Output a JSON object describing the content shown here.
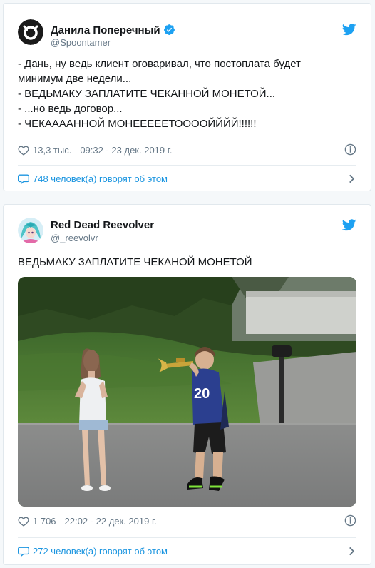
{
  "tweets": [
    {
      "author_name": "Данила Поперечный",
      "handle": "@Spoontamer",
      "verified": true,
      "text_lines": [
        "- Дань, ну ведь клиент оговаривал, что постоплата будет",
        "минимум две недели...",
        "- ВЕДЬМАКУ ЗАПЛАТИТЕ ЧЕКАННОЙ МОНЕТОЙ...",
        "- ...но ведь договор...",
        "- ЧЕКААААННОЙ МОНЕЕЕЕЕТООООЙЙЙЙ!!!!!!"
      ],
      "likes": "13,3 тыс.",
      "timestamp": "09:32 - 23 дек. 2019 г.",
      "discussion": "748 человек(а) говорят об этом"
    },
    {
      "author_name": "Red Dead Reevolver",
      "handle": "@_reevolvr",
      "verified": false,
      "text_lines": [
        "ВЕДЬМАКУ ЗАПЛАТИТЕ ЧЕКАНОЙ МОНЕТОЙ"
      ],
      "likes": "1 706",
      "timestamp": "22:02 - 22 дек. 2019 г.",
      "discussion": "272 человек(а) говорят об этом",
      "media_caption": "photo-girl-covering-ears-boy-playing-trumpet"
    }
  ],
  "colors": {
    "link": "#1b95e0",
    "twitter_blue": "#1da1f2",
    "secondary_text": "#657786",
    "border": "#e1e8ed"
  },
  "icons": [
    "twitter-bird-icon",
    "verified-badge-icon",
    "heart-icon",
    "info-icon",
    "comment-bubble-icon",
    "chevron-right-icon"
  ]
}
